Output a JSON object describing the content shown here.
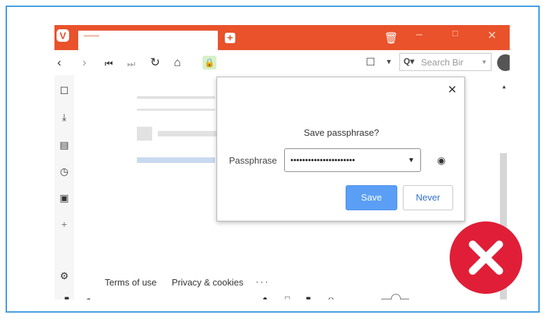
{
  "browser": {
    "logo_letter": "V",
    "search_placeholder": "Search Bir"
  },
  "dialog": {
    "title": "Save passphrase?",
    "label": "Passphrase",
    "password_masked": "••••••••••••••••••••••",
    "save_label": "Save",
    "never_label": "Never"
  },
  "footer": {
    "terms": "Terms of use",
    "privacy": "Privacy & cookies",
    "more": "···"
  },
  "colors": {
    "titlebar": "#e9522a",
    "accent_blue": "#5a9ff5",
    "error_red": "#e01e37",
    "frame_border": "#3d9be0"
  }
}
